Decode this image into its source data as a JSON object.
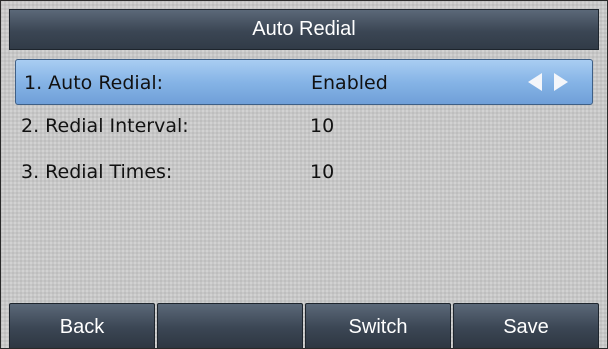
{
  "header": {
    "title": "Auto Redial"
  },
  "settings": [
    {
      "label": "1. Auto Redial:",
      "value": "Enabled",
      "selected": true
    },
    {
      "label": "2. Redial Interval:",
      "value": "10",
      "selected": false
    },
    {
      "label": "3. Redial Times:",
      "value": "10",
      "selected": false
    }
  ],
  "softkeys": {
    "key1": "Back",
    "key2": "",
    "key3": "Switch",
    "key4": "Save"
  },
  "colors": {
    "title_bar": "#3b4654",
    "selection": "#86b4e6",
    "background": "#c7c7c7"
  }
}
